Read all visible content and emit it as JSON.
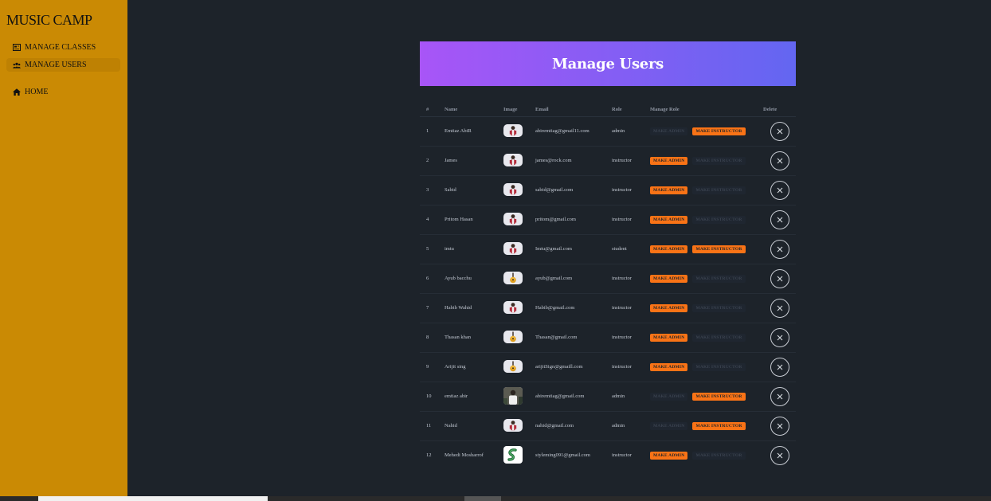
{
  "sidebar": {
    "brand": "MUSIC CAMP",
    "items": [
      {
        "label": "MANAGE CLASSES",
        "icon": "classes-icon"
      },
      {
        "label": "MANAGE USERS",
        "icon": "users-icon"
      },
      {
        "label": "HOME",
        "icon": "home-icon"
      }
    ]
  },
  "page": {
    "title": "Manage Users"
  },
  "table": {
    "headers": [
      "#",
      "Name",
      "Image",
      "Email",
      "Role",
      "Manage Role",
      "Delete"
    ],
    "make_admin_label": "MAKE ADMIN",
    "make_instructor_label": "MAKE INSTRUCTOR",
    "rows": [
      {
        "n": "1",
        "name": "Emtiaz AbiR",
        "email": "abiremtiag@gmail11.com",
        "role": "admin",
        "avatar": "person"
      },
      {
        "n": "2",
        "name": "James",
        "email": "james@rock.com",
        "role": "instructor",
        "avatar": "person"
      },
      {
        "n": "3",
        "name": "Sabid",
        "email": "sabid@gmail.com",
        "role": "instructor",
        "avatar": "person"
      },
      {
        "n": "4",
        "name": "Pritom Hasan",
        "email": "pritom@gmail.com",
        "role": "instructor",
        "avatar": "person"
      },
      {
        "n": "5",
        "name": "imtu",
        "email": "Imtu@gmail.com",
        "role": "student",
        "avatar": "person"
      },
      {
        "n": "6",
        "name": "Ayub bacchu",
        "email": "ayub@gmail.com",
        "role": "instructor",
        "avatar": "guitar"
      },
      {
        "n": "7",
        "name": "Habib Wahid",
        "email": "Habib@gmail.com",
        "role": "instructor",
        "avatar": "person"
      },
      {
        "n": "8",
        "name": "Thasan khan",
        "email": "Thasan@gmail.com",
        "role": "instructor",
        "avatar": "guitar"
      },
      {
        "n": "9",
        "name": "Arijit sing",
        "email": "arijitSign@gmaill.com",
        "role": "instructor",
        "avatar": "guitar"
      },
      {
        "n": "10",
        "name": "emtiaz abir",
        "email": "abiremtiag@gmail.com",
        "role": "admin",
        "avatar": "photo"
      },
      {
        "n": "11",
        "name": "Nahid",
        "email": "nahid@gmail.com",
        "role": "admin",
        "avatar": "person"
      },
      {
        "n": "12",
        "name": "Mehedi Mosharrof",
        "email": "styleming091@gmail.com",
        "role": "instructor",
        "avatar": "logo"
      }
    ]
  },
  "colors": {
    "sidebar": "#ca8a04",
    "background": "#1d232a",
    "header_gradient_start": "#a855f7",
    "header_gradient_end": "#6366f1",
    "button_active": "#f97316"
  }
}
